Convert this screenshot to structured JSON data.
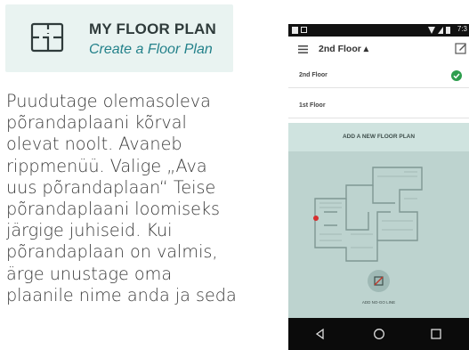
{
  "header": {
    "icon": "floor-plan-icon",
    "title": "MY FLOOR PLAN",
    "subtitle": "Create a Floor Plan",
    "accent_color": "#23818a",
    "background_color": "#e9f3f1"
  },
  "instructions": {
    "lines": [
      "Puudutage olemasoleva",
      "põrandaplaani kõrval",
      "olevat noolt. Avaneb",
      "rippmenüü. Valige „Ava",
      "uus põrandaplaan“ Teise",
      "põrandaplaani loomiseks",
      "järgige juhiseid. Kui",
      "põrandaplaan on valmis,",
      "ärge unustage oma",
      "plaanile nime anda ja seda"
    ]
  },
  "phone": {
    "status_bar": {
      "time": "7:3"
    },
    "app_bar": {
      "menu_icon": "hamburger-menu-icon",
      "title": "2nd Floor ▴",
      "edit_icon": "edit-icon"
    },
    "floors": [
      {
        "label": "2nd Floor",
        "selected": true
      },
      {
        "label": "1st Floor",
        "selected": false
      }
    ],
    "add_button_label": "ADD A NEW FLOOR PLAN",
    "no_go_label": "ADD NO-GO LINE",
    "nav": {
      "back": "back-icon",
      "home": "home-icon",
      "recent": "recent-apps-icon"
    },
    "colors": {
      "map_background": "#bdd3cf",
      "banner": "#cfe3df",
      "check": "#2e9e4e",
      "robot_marker": "#d62f2f"
    }
  }
}
